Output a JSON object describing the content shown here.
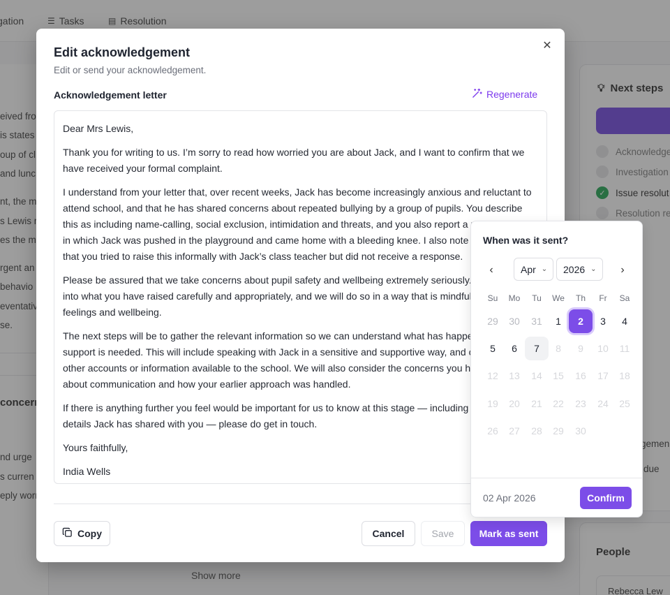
{
  "background": {
    "tabs": [
      {
        "icon": "search-icon",
        "label": "gation"
      },
      {
        "icon": "list-icon",
        "label": "Tasks"
      },
      {
        "icon": "document-icon",
        "label": "Resolution"
      }
    ],
    "left_lines": [
      "eived fro",
      "is states",
      "oup of cl",
      "and lunc",
      "nt, the m",
      "s Lewis re",
      "es the ma",
      "rgent an",
      "behavio",
      "eventativ",
      "se."
    ],
    "left_section_title": "concern",
    "left_lines_2": [
      "nd urge",
      "s curren",
      "eply worr"
    ],
    "show_more": "Show more",
    "next_steps_title": "Next steps",
    "steps": [
      {
        "label": "Acknowledge",
        "status": "pending"
      },
      {
        "label": "Investigation",
        "status": "pending"
      },
      {
        "label": "Issue resolut",
        "status": "done"
      },
      {
        "label": "Resolution re",
        "status": "pending"
      }
    ],
    "right_lines": [
      "gemen",
      "due"
    ],
    "people_title": "People",
    "people_item": "Rebecca Lew"
  },
  "modal": {
    "title": "Edit acknowledgement",
    "subtitle": "Edit or send your acknowledgement.",
    "field_label": "Acknowledgement letter",
    "regenerate_label": "Regenerate",
    "letter": [
      "Dear Mrs Lewis,",
      "Thank you for writing to us. I’m sorry to read how worried you are about Jack, and I want to confirm that we have received your formal complaint.",
      "I understand from your letter that, over recent weeks, Jack has become increasingly anxious and reluctant to attend school, and that he has shared concerns about repeated bullying by a group of pupils. You describe this as including name-calling, social exclusion, intimidation and threats, and you also report a recent incident in which Jack was pushed in the playground and came home with a bleeding knee. I also note your concern that you tried to raise this informally with Jack’s class teacher but did not receive a response.",
      "Please be assured that we take concerns about pupil safety and wellbeing extremely seriously. We will look into what you have raised carefully and appropriately, and we will do so in a way that is mindful of Jack’s feelings and wellbeing.",
      "The next steps will be to gather the relevant information so we can understand what has happened and what support is needed. This will include speaking with Jack in a sensitive and supportive way, and considering any other accounts or information available to the school. We will also consider the concerns you have raised about communication and how your earlier approach was handled.",
      "If there is anything further you feel would be important for us to know at this stage — including any further details Jack has shared with you — please do get in touch.",
      "Yours faithfully,",
      "India Wells"
    ],
    "copy_label": "Copy",
    "cancel_label": "Cancel",
    "save_label": "Save",
    "mark_sent_label": "Mark as sent"
  },
  "date_picker": {
    "title": "When was it sent?",
    "month": "Apr",
    "year": "2026",
    "weekdays": [
      "Su",
      "Mo",
      "Tu",
      "We",
      "Th",
      "Fr",
      "Sa"
    ],
    "weeks": [
      [
        {
          "d": "29",
          "t": "outside"
        },
        {
          "d": "30",
          "t": "outside"
        },
        {
          "d": "31",
          "t": "outside"
        },
        {
          "d": "1",
          "t": "current"
        },
        {
          "d": "2",
          "t": "selected"
        },
        {
          "d": "3",
          "t": "current"
        },
        {
          "d": "4",
          "t": "current"
        }
      ],
      [
        {
          "d": "5",
          "t": "current"
        },
        {
          "d": "6",
          "t": "current"
        },
        {
          "d": "7",
          "t": "today"
        },
        {
          "d": "8",
          "t": "disabled"
        },
        {
          "d": "9",
          "t": "disabled"
        },
        {
          "d": "10",
          "t": "disabled"
        },
        {
          "d": "11",
          "t": "disabled"
        }
      ],
      [
        {
          "d": "12",
          "t": "disabled"
        },
        {
          "d": "13",
          "t": "disabled"
        },
        {
          "d": "14",
          "t": "disabled"
        },
        {
          "d": "15",
          "t": "disabled"
        },
        {
          "d": "16",
          "t": "disabled"
        },
        {
          "d": "17",
          "t": "disabled"
        },
        {
          "d": "18",
          "t": "disabled"
        }
      ],
      [
        {
          "d": "19",
          "t": "disabled"
        },
        {
          "d": "20",
          "t": "disabled"
        },
        {
          "d": "21",
          "t": "disabled"
        },
        {
          "d": "22",
          "t": "disabled"
        },
        {
          "d": "23",
          "t": "disabled"
        },
        {
          "d": "24",
          "t": "disabled"
        },
        {
          "d": "25",
          "t": "disabled"
        }
      ],
      [
        {
          "d": "26",
          "t": "disabled"
        },
        {
          "d": "27",
          "t": "disabled"
        },
        {
          "d": "28",
          "t": "disabled"
        },
        {
          "d": "29",
          "t": "disabled"
        },
        {
          "d": "30",
          "t": "disabled"
        }
      ]
    ],
    "selected_date": "02 Apr 2026",
    "confirm_label": "Confirm"
  },
  "colors": {
    "accent": "#7c4de8",
    "success": "#16a34a"
  }
}
